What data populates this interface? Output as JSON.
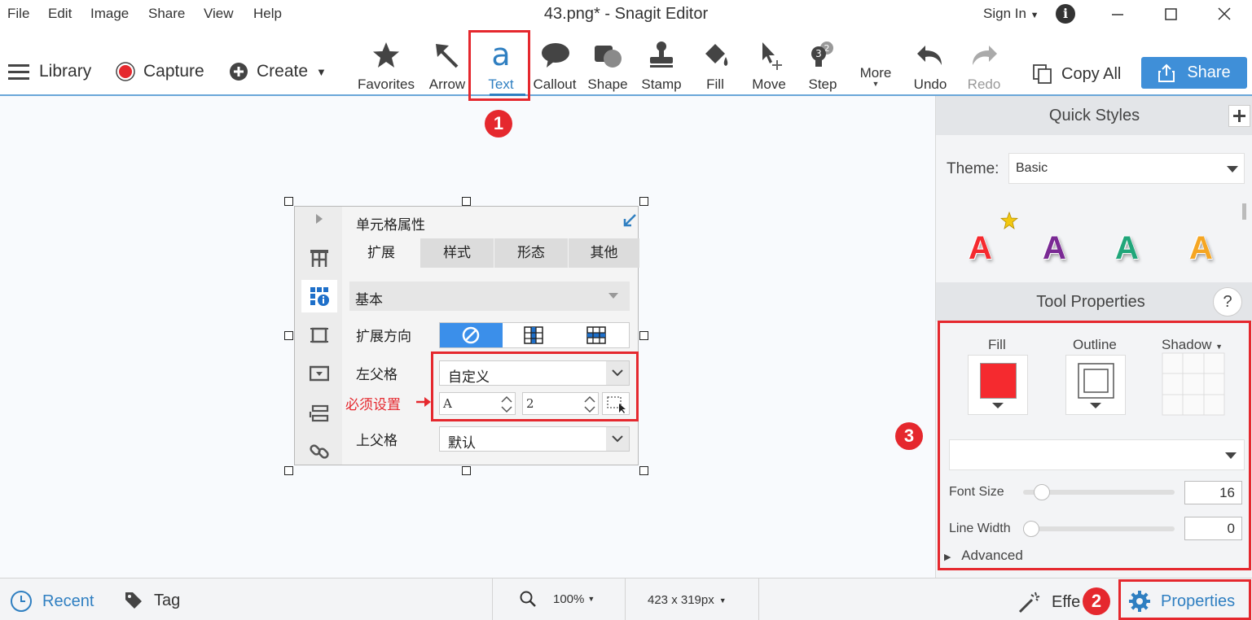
{
  "window": {
    "title": "43.png* - Snagit Editor",
    "signin": "Sign In"
  },
  "menu": [
    "File",
    "Edit",
    "Image",
    "Share",
    "View",
    "Help"
  ],
  "toolbar_left": {
    "library": "Library",
    "capture": "Capture",
    "create": "Create"
  },
  "tools": [
    "Favorites",
    "Arrow",
    "Text",
    "Callout",
    "Shape",
    "Stamp",
    "Fill",
    "Move",
    "Step",
    "More",
    "Undo",
    "Redo"
  ],
  "actions": {
    "copy_all": "Copy All",
    "share": "Share"
  },
  "quick_styles": {
    "header": "Quick Styles",
    "theme_label": "Theme:",
    "theme_value": "Basic",
    "swatches": [
      "A",
      "A",
      "A",
      "A"
    ]
  },
  "tool_properties": {
    "header": "Tool Properties",
    "help": "?",
    "fill_label": "Fill",
    "outline_label": "Outline",
    "shadow_label": "Shadow",
    "fill_color": "#f52a2f",
    "font_size_label": "Font Size",
    "font_size_value": "16",
    "font_size_fraction": 0.08,
    "line_width_label": "Line Width",
    "line_width_value": "0",
    "line_width_fraction": 0.0,
    "advanced": "Advanced"
  },
  "status": {
    "recent": "Recent",
    "tag": "Tag",
    "zoom": "100%",
    "dimensions": "423 x 319px",
    "effects": "Effe",
    "properties": "Properties"
  },
  "markers": [
    "1",
    "2",
    "3"
  ],
  "embedded": {
    "title": "单元格属性",
    "tabs": [
      "扩展",
      "样式",
      "形态",
      "其他"
    ],
    "section": "基本",
    "expand_dir_label": "扩展方向",
    "left_parent_label": "左父格",
    "left_parent_value": "自定义",
    "required_note": "必须设置",
    "col_value": "A",
    "row_value": "2",
    "top_parent_label": "上父格",
    "top_parent_value": "默认"
  },
  "colors": {
    "accent": "#3f8fd8",
    "annotation": "#e5282e",
    "active_tool": "#2f7fc1"
  }
}
